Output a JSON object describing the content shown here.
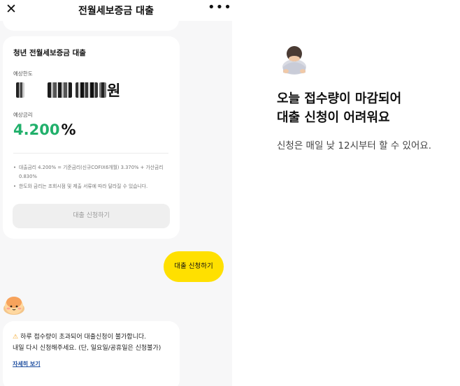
{
  "header": {
    "close_icon": "close-icon",
    "title": "전월세보증금 대출",
    "more_icon": "more-icon"
  },
  "loan_card": {
    "title": "청년 전월세보증금 대출",
    "limit_label": "예상한도",
    "limit_unit": "원",
    "rate_label": "예상금리",
    "rate_value": "4.200",
    "rate_unit": "%",
    "notes": [
      "대출금리 4.200% = 기준금리(신규COFIX6개월) 3.370% + 가산금리 0.830%",
      "한도와 금리는 조회시점 및 제출 서류에 따라 달라질 수 있습니다."
    ],
    "apply_button": "대출 신청하기"
  },
  "chat": {
    "user_bubble": "대출 신청하기",
    "bot_message_line1": "하루 접수량이 초과되어 대출신청이 불가합니다.",
    "bot_message_line2": "내일 다시 신청해주세요. (단, 일요일/공휴일은 신청불가)",
    "detail_link": "자세히 보기",
    "warning_icon": "warning-icon"
  },
  "notice": {
    "headline_line1": "오늘 접수량이 마감되어",
    "headline_line2": "대출 신청이 어려워요",
    "subtext": "신청은 매일 낮 12시부터 할 수 있어요."
  },
  "colors": {
    "accent_yellow": "#ffe000",
    "rate_green": "#21b06b",
    "link_blue": "#1f4fa0",
    "background_gray": "#f7f7f8"
  }
}
